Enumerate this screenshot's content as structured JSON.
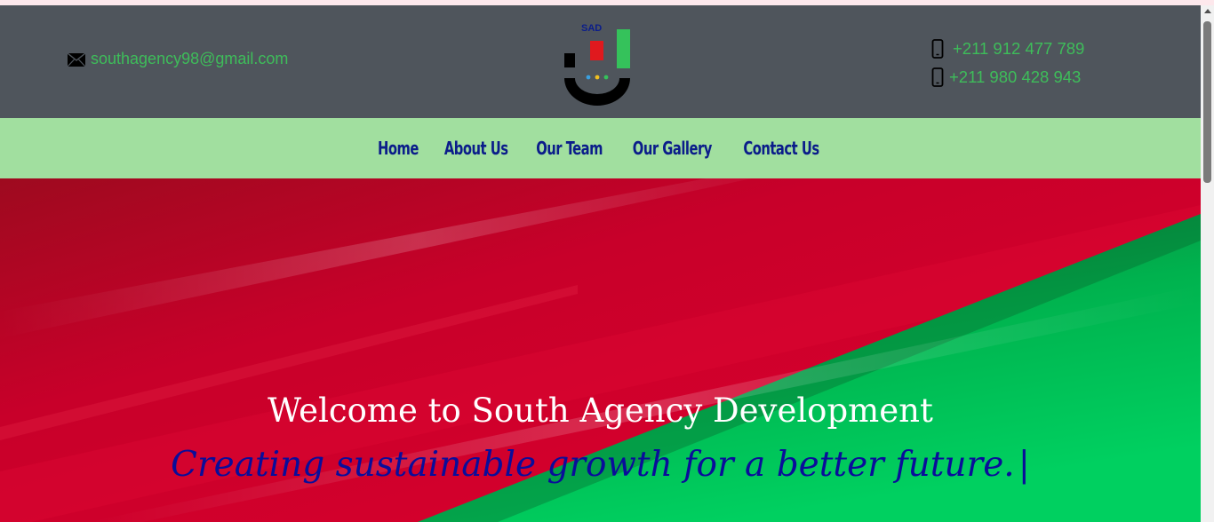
{
  "header": {
    "email": "southagency98@gmail.com",
    "logo_text": "SAD",
    "phones": [
      "+211 912 477 789",
      "+211 980 428 943"
    ]
  },
  "nav": {
    "items": [
      "Home",
      "About Us",
      "Our Team",
      "Our Gallery",
      "Contact Us"
    ]
  },
  "hero": {
    "title": "Welcome to South Agency Development",
    "subtitle": "Creating sustainable growth for a better future.",
    "cursor": "|"
  },
  "colors": {
    "header_bg": "#4f555c",
    "nav_bg": "#a1df9f",
    "nav_text": "#0b1d8a",
    "contact_text": "#3ebd5a",
    "hero_red": "#c8002a",
    "hero_green": "#00b24e"
  },
  "icons": {
    "email": "envelope-icon",
    "phone": "mobile-phone-icon"
  }
}
